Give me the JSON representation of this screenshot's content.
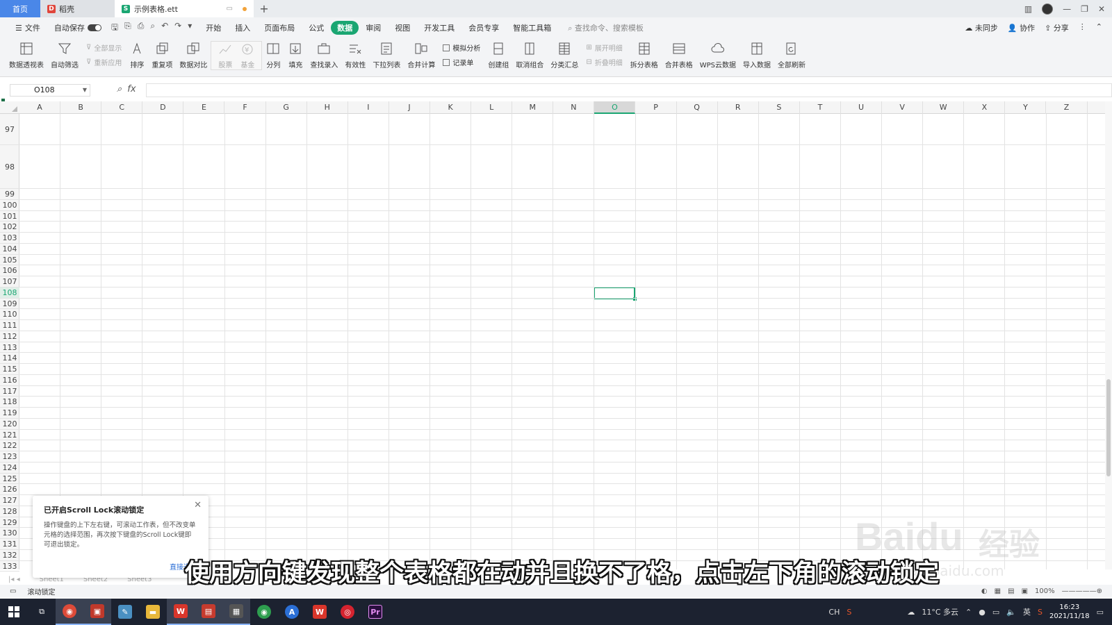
{
  "titlebar": {
    "home_tab": "首页",
    "daoke_tab": "稻壳",
    "file_tab": "示例表格.ett",
    "new_tab": "+"
  },
  "menubar": {
    "file": "文件",
    "autosave": "自动保存",
    "items": [
      "开始",
      "插入",
      "页面布局",
      "公式",
      "数据",
      "审阅",
      "视图",
      "开发工具",
      "会员专享",
      "智能工具箱"
    ],
    "active": "数据",
    "search_placeholder": "查找命令、搜索模板",
    "right": [
      "未同步",
      "协作",
      "分享"
    ]
  },
  "ribbon": {
    "pivot": "数据透视表",
    "autofilter": "自动筛选",
    "show_all": "全部显示",
    "reapply": "重新应用",
    "sort": "排序",
    "duplicates": "重复项",
    "compare": "数据对比",
    "stock": "股票",
    "fund": "基金",
    "split_col": "分列",
    "fill": "填充",
    "lookup": "查找录入",
    "validity": "有效性",
    "dropdown": "下拉列表",
    "consolidate": "合并计算",
    "whatif": "模拟分析",
    "record": "记录单",
    "group": "创建组",
    "ungroup": "取消组合",
    "subtotal": "分类汇总",
    "expand": "展开明细",
    "collapse": "折叠明细",
    "split_table": "拆分表格",
    "merge_table": "合并表格",
    "wps_cloud": "WPS云数据",
    "import": "导入数据",
    "refresh_all": "全部刷新"
  },
  "formulabar": {
    "cell_ref": "O108",
    "fx": "fx",
    "formula": ""
  },
  "sheet": {
    "columns": [
      "A",
      "B",
      "C",
      "D",
      "E",
      "F",
      "G",
      "H",
      "I",
      "J",
      "K",
      "L",
      "M",
      "N",
      "O",
      "P",
      "Q",
      "R",
      "S",
      "T",
      "U",
      "V",
      "W",
      "X",
      "Y",
      "Z"
    ],
    "selected_column": "O",
    "rows": [
      "97",
      "98",
      "99",
      "100",
      "101",
      "102",
      "103",
      "104",
      "105",
      "106",
      "107",
      "108",
      "109",
      "110",
      "111",
      "112",
      "113",
      "114",
      "115",
      "116",
      "117",
      "118",
      "119",
      "120",
      "121",
      "122",
      "123",
      "124",
      "125",
      "126",
      "127",
      "128",
      "129",
      "130",
      "131",
      "132",
      "133"
    ],
    "selected_row": "108"
  },
  "popup": {
    "title": "已开启Scroll Lock滚动锁定",
    "body": "操作键盘的上下左右键，可滚动工作表，但不改变单元格的选择范围，再次按下键盘的Scroll Lock键即可退出锁定。",
    "link": "直接退"
  },
  "sheettabs": [
    "Sheet1",
    "Sheet2",
    "Sheet3"
  ],
  "statusbar": {
    "scroll_lock": "滚动锁定",
    "zoom": "100%"
  },
  "subtitle": "使用方向键发现整个表格都在动并且换不了格，点击左下角的滚动锁定",
  "watermark": {
    "brand": "Baidu",
    "jy": "经验",
    "url": "jingyan.baidu.com"
  },
  "taskbar": {
    "weather": "11°C 多云",
    "ime": "英",
    "lang": "CH",
    "time": "16:23",
    "date": "2021/11/18"
  },
  "colors": {
    "accent": "#1aa672",
    "home_tab": "#4a87e8",
    "taskbar": "#1c2230"
  }
}
